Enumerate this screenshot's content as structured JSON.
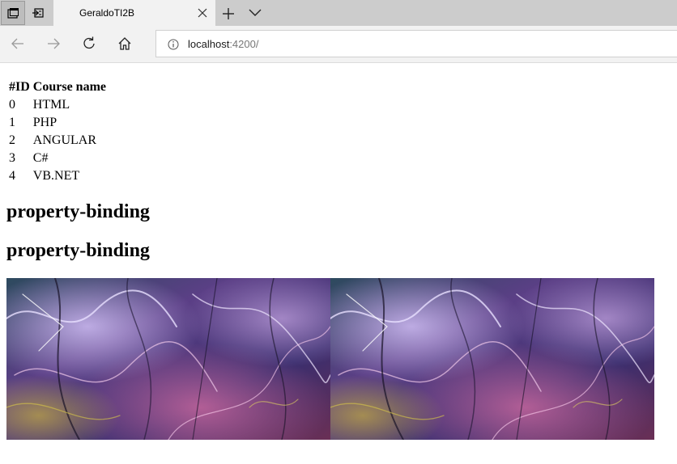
{
  "browser": {
    "tab_title": "GeraldoTI2B",
    "url_host": "localhost",
    "url_rest": ":4200/"
  },
  "icons": {
    "tab_actions": "tab-actions-icon",
    "set_aside": "set-aside-tabs-icon",
    "close": "close-icon",
    "new_tab": "plus-icon",
    "tab_list": "chevron-down-icon",
    "back": "arrow-left-icon",
    "forward": "arrow-right-icon",
    "refresh": "refresh-icon",
    "home": "home-icon",
    "site_info": "info-icon"
  },
  "page": {
    "table": {
      "headers": [
        "#ID",
        "Course name"
      ],
      "rows": [
        [
          "0",
          "HTML"
        ],
        [
          "1",
          "PHP"
        ],
        [
          "2",
          "ANGULAR"
        ],
        [
          "3",
          "C#"
        ],
        [
          "4",
          "VB.NET"
        ]
      ]
    },
    "headings": [
      "property-binding",
      "property-binding"
    ]
  }
}
